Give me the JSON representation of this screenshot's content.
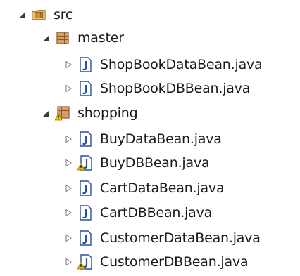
{
  "tree": {
    "root": {
      "label": "src"
    },
    "packages": [
      {
        "label": "master",
        "files": [
          {
            "label": "ShopBookDataBean.java",
            "warning": false
          },
          {
            "label": "ShopBookDBBean.java",
            "warning": false
          }
        ]
      },
      {
        "label": "shopping",
        "warning": true,
        "files": [
          {
            "label": "BuyDataBean.java",
            "warning": false
          },
          {
            "label": "BuyDBBean.java",
            "warning": true
          },
          {
            "label": "CartDataBean.java",
            "warning": false
          },
          {
            "label": "CartDBBean.java",
            "warning": false
          },
          {
            "label": "CustomerDataBean.java",
            "warning": false
          },
          {
            "label": "CustomerDBBean.java",
            "warning": true
          }
        ]
      }
    ]
  },
  "colors": {
    "text": "#1a1a1a",
    "package_brown": "#8b5a2b",
    "java_blue": "#2a4fa0",
    "warning_yellow": "#f2c200",
    "toggle_gray": "#7a7a7a"
  }
}
